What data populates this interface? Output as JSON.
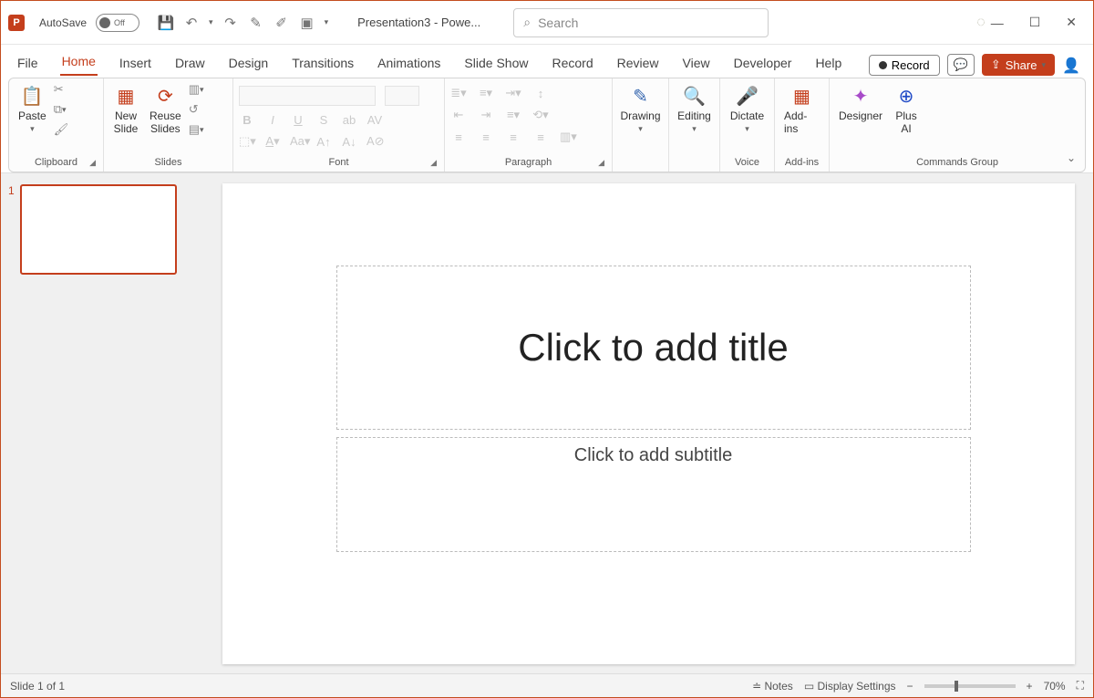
{
  "titlebar": {
    "autosave_label": "AutoSave",
    "autosave_state": "Off",
    "doc_title": "Presentation3 - Powe...",
    "search_placeholder": "Search"
  },
  "tabs": {
    "items": [
      "File",
      "Home",
      "Insert",
      "Draw",
      "Design",
      "Transitions",
      "Animations",
      "Slide Show",
      "Record",
      "Review",
      "View",
      "Developer",
      "Help"
    ],
    "active": "Home",
    "record_label": "Record",
    "share_label": "Share"
  },
  "ribbon": {
    "clipboard": {
      "label": "Clipboard",
      "paste": "Paste"
    },
    "slides": {
      "label": "Slides",
      "new_slide": "New\nSlide",
      "reuse": "Reuse\nSlides"
    },
    "font": {
      "label": "Font"
    },
    "paragraph": {
      "label": "Paragraph"
    },
    "drawing": {
      "label": "Drawing"
    },
    "editing": {
      "label": "Editing"
    },
    "voice": {
      "label": "Voice",
      "dictate": "Dictate"
    },
    "addins": {
      "label": "Add-ins",
      "btn": "Add-ins"
    },
    "commands": {
      "label": "Commands Group",
      "designer": "Designer",
      "plusai": "Plus\nAI"
    }
  },
  "slide": {
    "number": "1",
    "title_placeholder": "Click to add title",
    "subtitle_placeholder": "Click to add subtitle"
  },
  "status": {
    "slide_info": "Slide 1 of 1",
    "notes": "Notes",
    "display": "Display Settings",
    "zoom": "70%"
  }
}
